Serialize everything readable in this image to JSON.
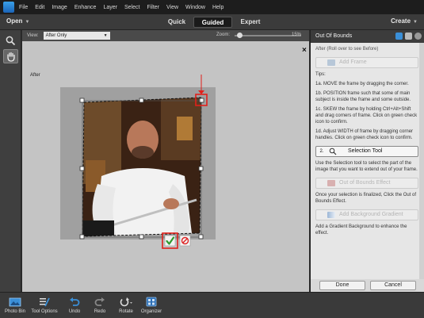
{
  "menubar": {
    "items": [
      "File",
      "Edit",
      "Image",
      "Enhance",
      "Layer",
      "Select",
      "Filter",
      "View",
      "Window",
      "Help"
    ]
  },
  "modebar": {
    "open_label": "Open",
    "tabs": [
      "Quick",
      "Guided",
      "Expert"
    ],
    "active_tab": "Guided",
    "create_label": "Create"
  },
  "optionsbar": {
    "view_label": "View:",
    "view_value": "After Only",
    "zoom_label": "Zoom:",
    "zoom_value": "15%"
  },
  "canvas": {
    "after_label": "After",
    "close_glyph": "×"
  },
  "panel": {
    "title": "Out Of Bounds",
    "after_note": "After (Roll over to see Before)",
    "step1_label": "Add Frame",
    "tips_heading": "Tips:",
    "tip_1a": "1a. MOVE the frame by dragging the corner.",
    "tip_1b": "1b. POSITION frame such that some of main subject is inside the frame and some outside.",
    "tip_1c": "1c. SKEW the frame by holding Ctrl+Alt+Shift and drag corners of frame. Click on green check icon to confirm.",
    "tip_1d": "1d. Adjust WIDTH of frame by dragging corner handles. Click on green check icon to confirm.",
    "step2_number": "2.",
    "step2_label": "Selection Tool",
    "step2_desc": "Use the Selection tool to select the part of the image that you want to extend out of your frame.",
    "step3_label": "Out of Bounds Effect",
    "step3_desc": "Once your selection is finalized, Click the Out of Bounds Effect.",
    "step4_label": "Add Background Gradient",
    "step4_desc": "Add a Gradient Background to enhance the effect.",
    "done_label": "Done",
    "cancel_label": "Cancel"
  },
  "bottombar": {
    "items": [
      {
        "label": "Photo Bin",
        "icon": "photo-bin-icon"
      },
      {
        "label": "Tool Options",
        "icon": "tool-options-icon"
      },
      {
        "label": "Undo",
        "icon": "undo-icon"
      },
      {
        "label": "Redo",
        "icon": "redo-icon"
      },
      {
        "label": "Rotate",
        "icon": "rotate-icon"
      },
      {
        "label": "Organizer",
        "icon": "organizer-icon"
      }
    ]
  },
  "colors": {
    "accent_red": "#e0201b",
    "confirm_green": "#2e9a2e",
    "app_dark": "#2b2b2b",
    "panel_light": "#e6e6e6"
  }
}
